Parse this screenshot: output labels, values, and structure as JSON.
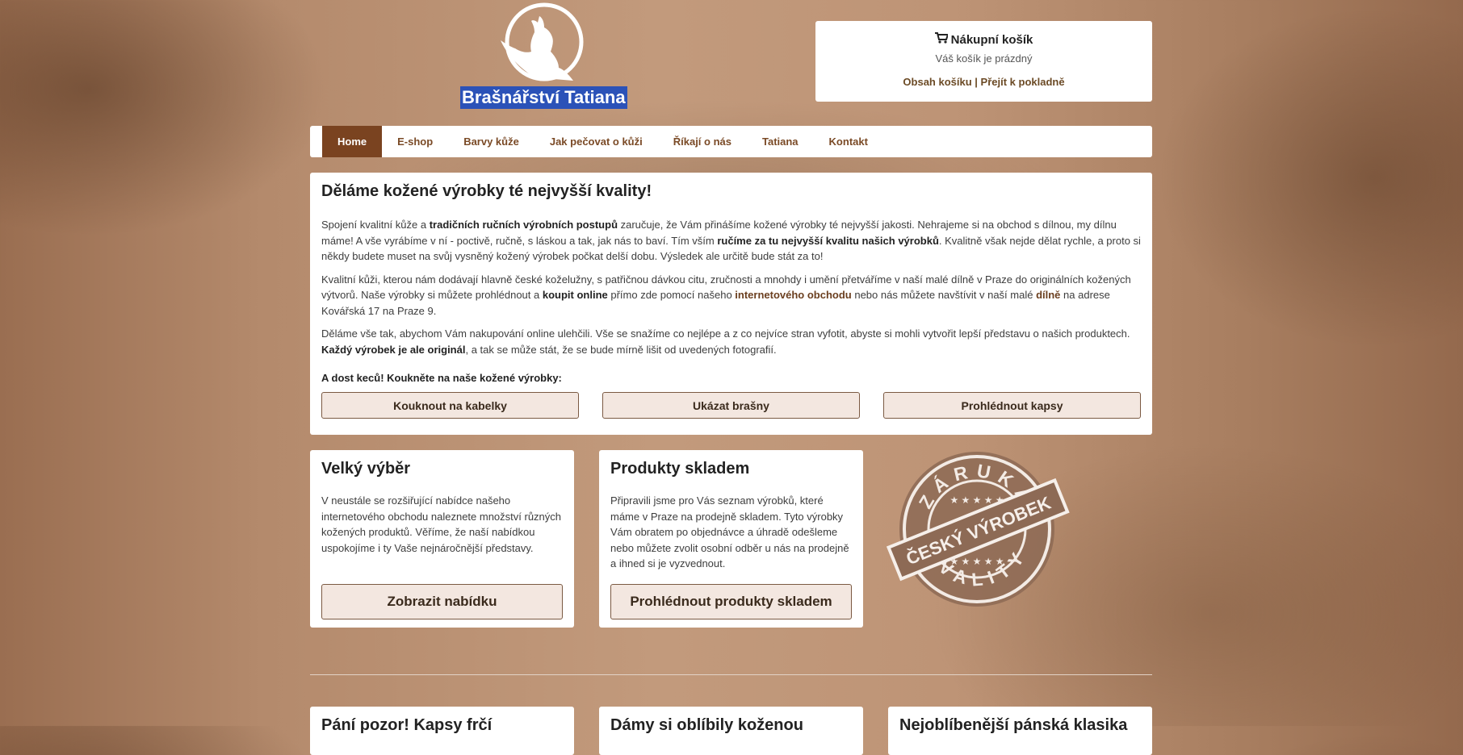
{
  "header": {
    "logo_text": "Brašnářství Tatiana",
    "logo_icon": "howling-wolf-icon"
  },
  "cart": {
    "title": "Nákupní košík",
    "icon": "cart-icon",
    "status": "Váš košík je prázdný",
    "link_contents": "Obsah košíku",
    "separator": "|",
    "link_checkout": "Přejít k pokladně"
  },
  "nav": {
    "items": [
      {
        "label": "Home",
        "active": true
      },
      {
        "label": "E-shop"
      },
      {
        "label": "Barvy kůže"
      },
      {
        "label": "Jak pečovat o kůži"
      },
      {
        "label": "Říkají o nás"
      },
      {
        "label": "Tatiana"
      },
      {
        "label": "Kontakt"
      }
    ]
  },
  "intro": {
    "title": "Děláme kožené výrobky té nejvyšší kvality!",
    "p1": {
      "a": "Spojení kvalitní kůže a ",
      "b": "tradičních ručních výrobních postupů",
      "c": " zaručuje, že Vám přinášíme kožené výrobky té nejvyšší jakosti. Nehrajeme si na obchod s dílnou, my dílnu máme! A vše vyrábíme v ní - poctivě, ručně, s láskou a tak, jak nás to baví. Tím vším ",
      "d": "ručíme za tu nejvyšší kvalitu našich výrobků",
      "e": ". Kvalitně však nejde dělat rychle, a proto si někdy budete muset na svůj vysněný kožený výrobek počkat delší dobu. Výsledek ale určitě bude stát za to!"
    },
    "p2": {
      "a": "Kvalitní kůži, kterou nám dodávají hlavně české koželužny, s patřičnou dávkou citu, zručnosti a mnohdy i umění přetváříme v naší malé dílně v Praze do originálních kožených výtvorů. Naše výrobky si můžete prohlédnout a ",
      "b": "koupit online",
      "c": " přímo zde pomocí našeho ",
      "d": "internetového obchodu",
      "e": " nebo nás můžete navštívit v naší malé ",
      "f": "dílně",
      "g": " na adrese Kovářská 17 na Praze 9."
    },
    "p3": {
      "a": "Děláme vše tak, abychom Vám nakupování online ulehčili. Vše se snažíme co nejlépe a z co nejvíce stran vyfotit, abyste si mohli vytvořit lepší představu o našich produktech. ",
      "b": "Každý výrobek je ale originál",
      "c": ", a tak se může stát, že se bude mírně lišit od uvedených fotografií."
    },
    "cta": "A dost keců! Koukněte na naše kožené výrobky:",
    "buttons": [
      "Kouknout na kabelky",
      "Ukázat brašny",
      "Prohlédnout kapsy"
    ]
  },
  "cards": [
    {
      "title": "Velký výběr",
      "text": "V neustále se rozšiřující nabídce našeho internetového obchodu naleznete množství různých kožených produktů. Věříme, že naší nabídkou uspokojíme i ty Vaše nejnáročnější představy.",
      "button": "Zobrazit nabídku"
    },
    {
      "title": "Produkty skladem",
      "text": "Připravili jsme pro Vás seznam výrobků, které máme v Praze na prodejně skladem. Tyto výrobky Vám obratem po objednávce a úhradě odešleme nebo můžete zvolit osobní odběr u nás na prodejně a ihned si je vyzvednout.",
      "button": "Prohlédnout produkty skladem"
    }
  ],
  "badge": {
    "top": "ZÁRUKA",
    "middle": "ČESKÝ VÝROBEK",
    "bottom": "KVALITY",
    "icon": "quality-stamp-icon"
  },
  "teasers": [
    {
      "title": "Pání pozor! Kapsy frčí"
    },
    {
      "title": "Dámy si oblíbily koženou"
    },
    {
      "title": "Nejoblíbenější pánská klasika"
    }
  ],
  "colors": {
    "accent": "#7a4320",
    "link": "#7a4a26",
    "button_bg": "#f3e7e0",
    "logo_bg": "#2b52b8"
  }
}
